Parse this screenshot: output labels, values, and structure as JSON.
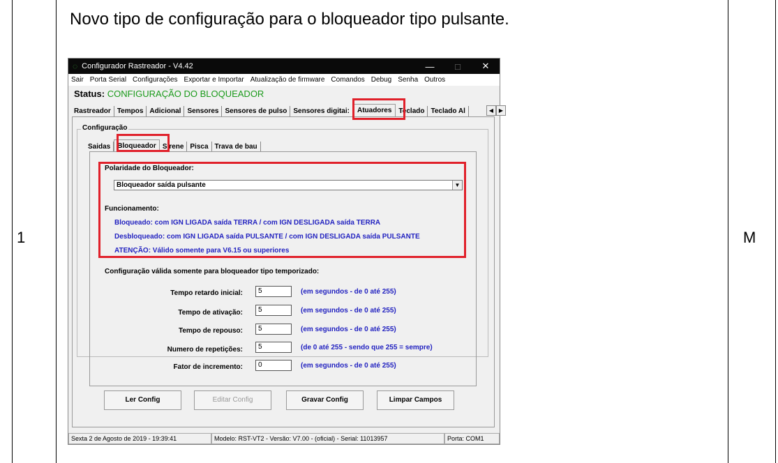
{
  "document": {
    "heading": "Novo tipo de configuração para o bloqueador tipo pulsante.",
    "row_number": "1",
    "row_code": "M"
  },
  "window": {
    "title": "Configurador Rastreador - V4.42",
    "controls": {
      "minimize": "—",
      "maximize": "□",
      "close": "✕"
    },
    "menu": [
      "Sair",
      "Porta Serial",
      "Configurações",
      "Exportar e Importar",
      "Atualização de firmware",
      "Comandos",
      "Debug",
      "Senha",
      "Outros"
    ],
    "status_label": "Status:",
    "status_value": "CONFIGURAÇÃO DO BLOQUEADOR",
    "tabs": [
      "Rastreador",
      "Tempos",
      "Adicional",
      "Sensores",
      "Sensores de pulso",
      "Sensores digitai:",
      "Atuadores",
      "Teclado",
      "Teclado Al"
    ],
    "active_tab": "Atuadores",
    "group_label": "Configuração",
    "subtabs": [
      "Saidas",
      "Bloqueador",
      "Sirene",
      "Pisca",
      "Trava de bau"
    ],
    "active_subtab": "Bloqueador",
    "polarity_label": "Polaridade do Bloqueador:",
    "polarity_selected": "Bloqueador saída pulsante",
    "func_title": "Funcionamento:",
    "func_lines": [
      "Bloqueado: com IGN LIGADA saída TERRA / com IGN DESLIGADA saída TERRA",
      "Desbloqueado: com IGN LIGADA saída PULSANTE / com IGN DESLIGADA saída PULSANTE",
      "ATENÇÃO: Válido somente para V6.15 ou superiores"
    ],
    "temp_title": "Configuração válida somente para bloqueador tipo temporizado:",
    "fields": [
      {
        "label": "Tempo retardo inicial:",
        "value": "5",
        "hint": "(em segundos - de 0 até 255)"
      },
      {
        "label": "Tempo de ativação:",
        "value": "5",
        "hint": "(em segundos - de 0 até 255)"
      },
      {
        "label": "Tempo de repouso:",
        "value": "5",
        "hint": "(em segundos - de 0 até 255)"
      },
      {
        "label": "Numero de repetições:",
        "value": "5",
        "hint": "(de 0 até 255 - sendo que 255 = sempre)"
      },
      {
        "label": "Fator de incremento:",
        "value": "0",
        "hint": "(em segundos - de 0 até 255)"
      }
    ],
    "buttons": {
      "read": "Ler Config",
      "edit": "Editar Config",
      "write": "Gravar Config",
      "clear": "Limpar Campos"
    },
    "statusbar": {
      "datetime": "Sexta 2 de Agosto de 2019  -  19:39:41",
      "model": "Modelo: RST-VT2  -  Versão: V7.00 - (oficial)  -  Serial: 11013957",
      "port": "Porta: COM1"
    },
    "highlight_color": "#e0202a",
    "info_text_color": "#2222c0",
    "status_color": "#1a9a1a"
  }
}
